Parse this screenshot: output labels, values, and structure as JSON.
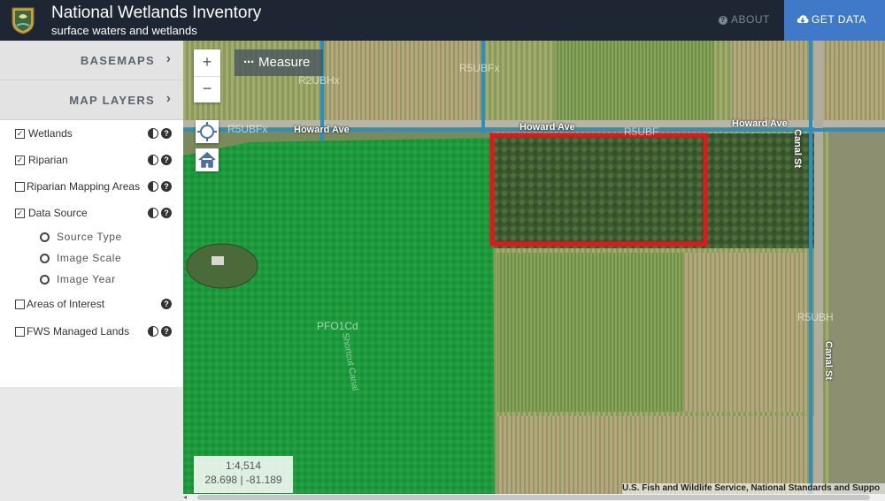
{
  "header": {
    "title": "National Wetlands Inventory",
    "subtitle": "surface waters and wetlands",
    "about_label": "ABOUT",
    "get_data_label": "GET DATA"
  },
  "sidebar": {
    "basemaps_label": "BASEMAPS",
    "map_layers_label": "MAP LAYERS",
    "layers": [
      {
        "label": "Wetlands",
        "checked": true
      },
      {
        "label": "Riparian",
        "checked": true
      },
      {
        "label": "Riparian Mapping Areas",
        "checked": false
      },
      {
        "label": "Data Source",
        "checked": true
      },
      {
        "label": "Areas of Interest",
        "checked": false
      },
      {
        "label": "FWS Managed Lands",
        "checked": false
      }
    ],
    "data_source_options": [
      "Source Type",
      "Image Scale",
      "Image Year"
    ]
  },
  "map": {
    "measure_label": "Measure",
    "zoom_in": "+",
    "zoom_out": "−",
    "scale": "1:4,514",
    "coordinates": "28.698 | -81.189",
    "attribution": "U.S. Fish and Wildlife Service, National Standards and Suppo",
    "labels": {
      "road_howard_1": "Howard Ave",
      "road_howard_2": "Howard Ave",
      "road_howard_3": "Howard Ave",
      "road_canal_1": "Canal St",
      "road_canal_2": "Canal St",
      "shortcut_canal": "Shortcut Canal",
      "wet_r5ubfx_1": "R5UBFx",
      "wet_r5ubfx_2": "R5UBFx",
      "wet_r2ubhx": "R2UBHx",
      "wet_pfo1cd": "PFO1Cd",
      "wet_r5ubh": "R5UBH",
      "wet_r5ubfx_3": "R5UBF"
    }
  },
  "colors": {
    "header_bg": "#1f2633",
    "get_data_bg": "#3f79c7",
    "wetland_fill": "#1a9a3a",
    "highlight_box": "#e8141c",
    "riverine": "#2b8fc4"
  }
}
